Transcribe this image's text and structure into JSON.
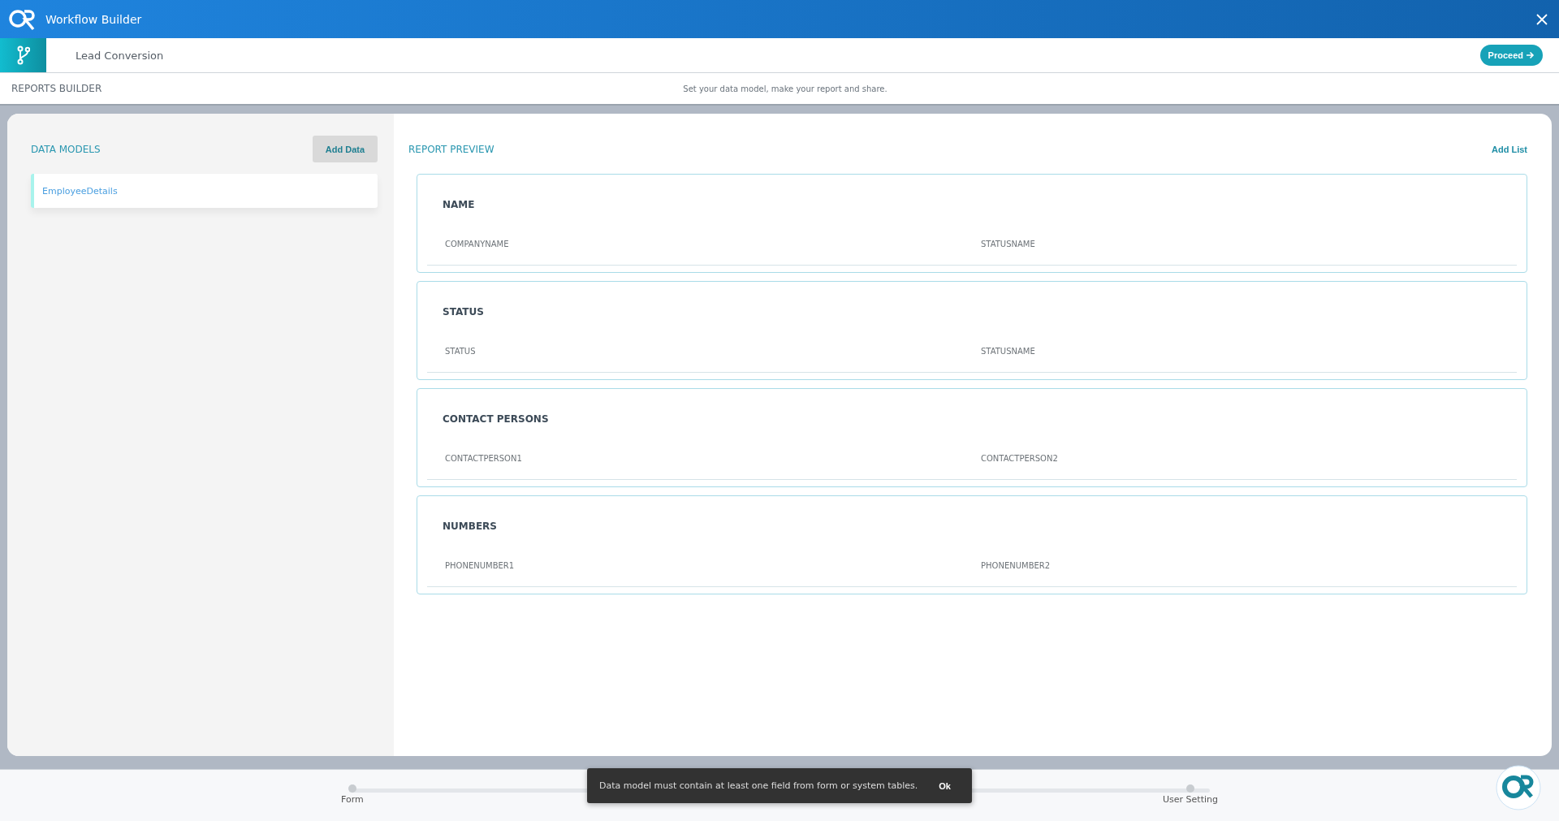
{
  "window": {
    "title": "Workflow Builder"
  },
  "header": {
    "workflow_name": "Lead Conversion",
    "proceed_button": "Proceed"
  },
  "section": {
    "title": "REPORTS BUILDER",
    "subtitle": "Set your data model, make your report and share."
  },
  "data_models": {
    "title": "DATA MODELS",
    "add_button": "Add Data",
    "items": [
      {
        "label": "EmployeeDetails",
        "selected": true
      }
    ]
  },
  "report_preview": {
    "title": "REPORT PREVIEW",
    "add_button": "Add List",
    "lists": [
      {
        "title": "NAME",
        "fields": [
          "COMPANYNAME",
          "STATUSNAME"
        ]
      },
      {
        "title": "STATUS",
        "fields": [
          "STATUS",
          "STATUSNAME"
        ]
      },
      {
        "title": "CONTACT PERSONS",
        "fields": [
          "CONTACTPERSON1",
          "CONTACTPERSON2"
        ]
      },
      {
        "title": "NUMBERS",
        "fields": [
          "PHONENUMBER1",
          "PHONENUMBER2"
        ]
      }
    ]
  },
  "stepper": {
    "steps": [
      "Form",
      "User Setting"
    ]
  },
  "toast": {
    "message": "Data model must contain at least one field from form or system tables.",
    "action": "Ok"
  }
}
